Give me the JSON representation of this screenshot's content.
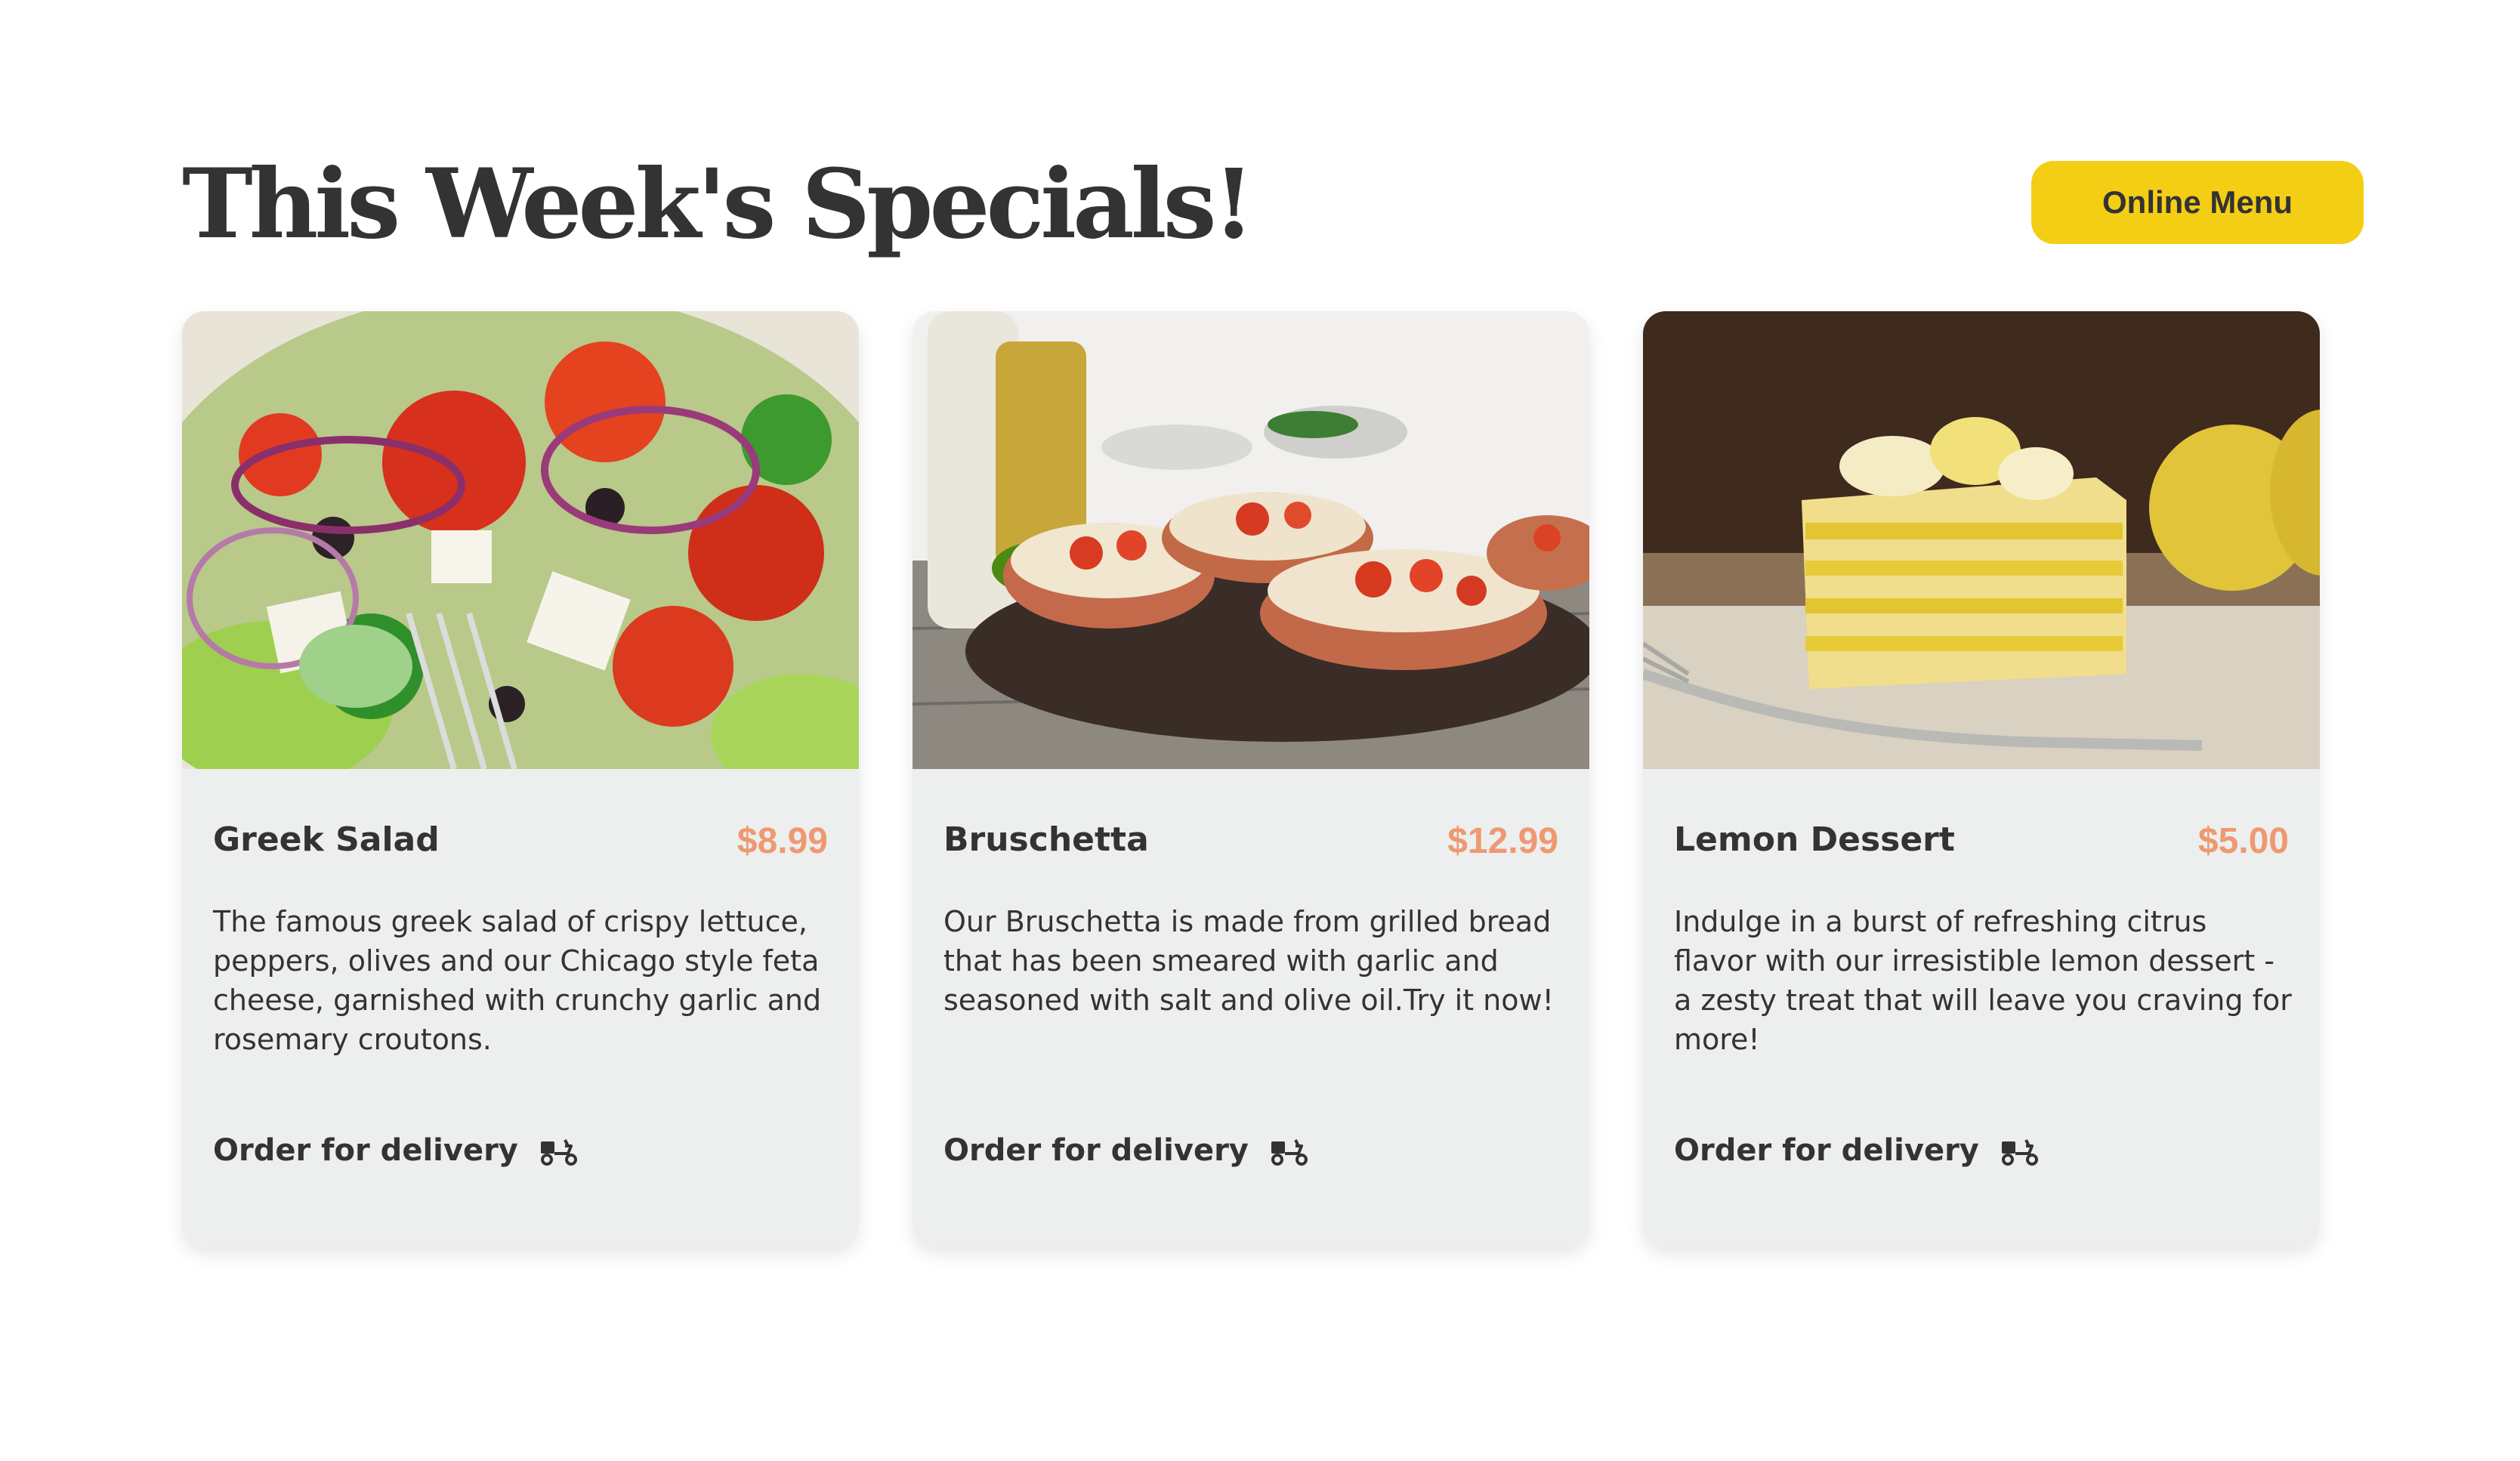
{
  "header": {
    "title": "This Week's Specials!",
    "button_label": "Online Menu"
  },
  "colors": {
    "accent_yellow": "#F4CE14",
    "price_salmon": "#EE9972",
    "card_bg": "#EDEFEE",
    "text_dark": "#333333"
  },
  "cards": [
    {
      "name": "Greek Salad",
      "price": "$8.99",
      "description": "The famous greek salad of crispy lettuce, peppers, olives and our Chicago style feta cheese, garnished with crunchy garlic and rosemary croutons.",
      "order_label": "Order for delivery",
      "icon": "delivery-scooter-icon"
    },
    {
      "name": "Bruschetta",
      "price": "$12.99",
      "description": "Our Bruschetta is made from grilled bread that has been smeared with garlic and seasoned with salt and olive oil.Try it now!",
      "order_label": "Order for delivery",
      "icon": "delivery-scooter-icon"
    },
    {
      "name": "Lemon Dessert",
      "price": "$5.00",
      "description": "Indulge in a burst of refreshing citrus flavor with our irresistible lemon dessert - a zesty treat that will leave you craving for more!",
      "order_label": "Order for delivery",
      "icon": "delivery-scooter-icon"
    }
  ]
}
